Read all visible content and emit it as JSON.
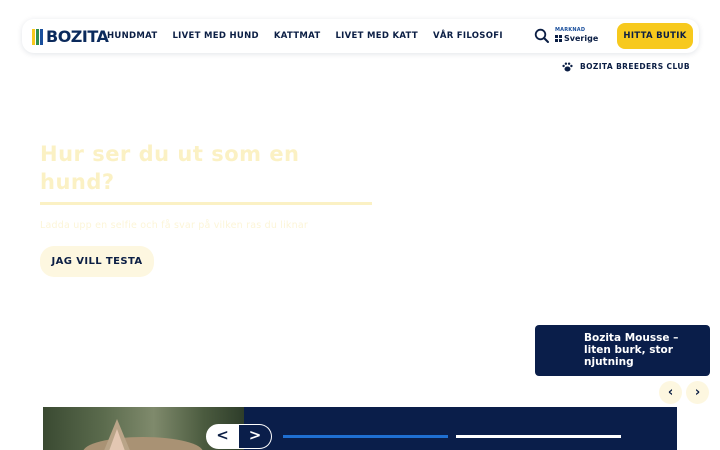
{
  "header": {
    "logo_text": "BOZITA",
    "logo_colors": [
      "#f7c91d",
      "#2f8f4e",
      "#1a4f9c"
    ],
    "nav": [
      {
        "label": "HUNDMAT"
      },
      {
        "label": "LIVET MED HUND"
      },
      {
        "label": "KATTMAT"
      },
      {
        "label": "LIVET MED KATT"
      },
      {
        "label": "VÅR FILOSOFI"
      }
    ],
    "search_icon": "search-icon",
    "market_label": "MARKNAD",
    "market_value": "Sverige",
    "find_store_label": "HITTA BUTIK",
    "accent_color": "#f7c91d"
  },
  "breeders": {
    "label": "BOZITA BREEDERS CLUB",
    "icon": "paw-icon"
  },
  "hero": {
    "title": "Hur ser du ut som en hund?",
    "subtitle": "Ladda upp en selfie och få svar på vilken ras du liknar",
    "cta_label": "JAG VILL TESTA"
  },
  "promo": {
    "text": "Bozita Mousse – liten burk, stor njutning",
    "prev_label": "‹",
    "next_label": "›"
  },
  "banner": {
    "prev_label": "<",
    "next_label": ">",
    "progress": [
      {
        "color": "#1f6fd1"
      },
      {
        "color": "#ffffff"
      }
    ]
  }
}
